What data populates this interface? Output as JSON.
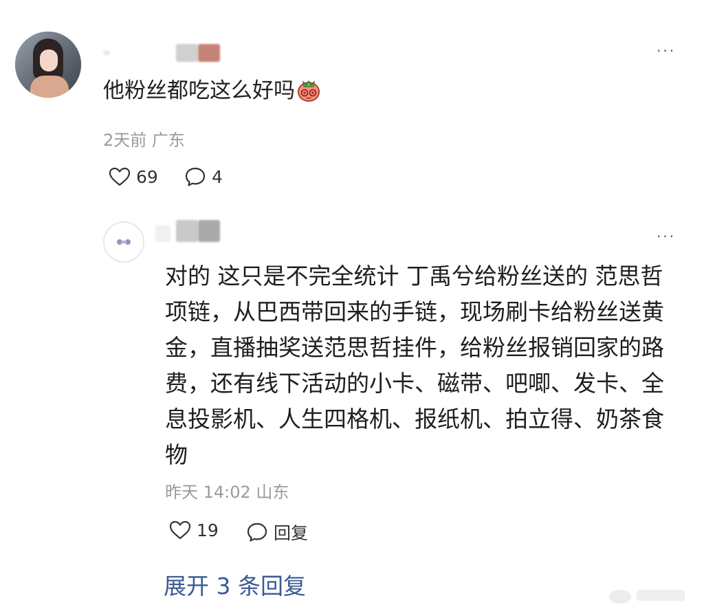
{
  "top_comment": {
    "avatar_alt": "user-avatar",
    "username_hidden": true,
    "text": "他粉丝都吃这么好吗",
    "emoji": "strawberry-emoji",
    "time_location": "2天前 广东",
    "likes": "69",
    "replies": "4",
    "more": "···"
  },
  "reply_comment": {
    "username_hidden": true,
    "text": "对的 这只是不完全统计 丁禹兮给粉丝送的 范思哲项链，从巴西带回来的手链，现场刷卡给粉丝送黄金，直播抽奖送范思哲挂件，给粉丝报销回家的路费，还有线下活动的小卡、磁带、吧唧、发卡、全息投影机、人生四格机、报纸机、拍立得、奶茶食物",
    "time_location": "昨天 14:02 山东",
    "likes": "19",
    "reply_label": "回复",
    "more": "···"
  },
  "expand_replies": "展开 3 条回复",
  "colors": {
    "link": "#3a5a92",
    "meta": "#9a9a9a",
    "text": "#1f1f1f"
  }
}
